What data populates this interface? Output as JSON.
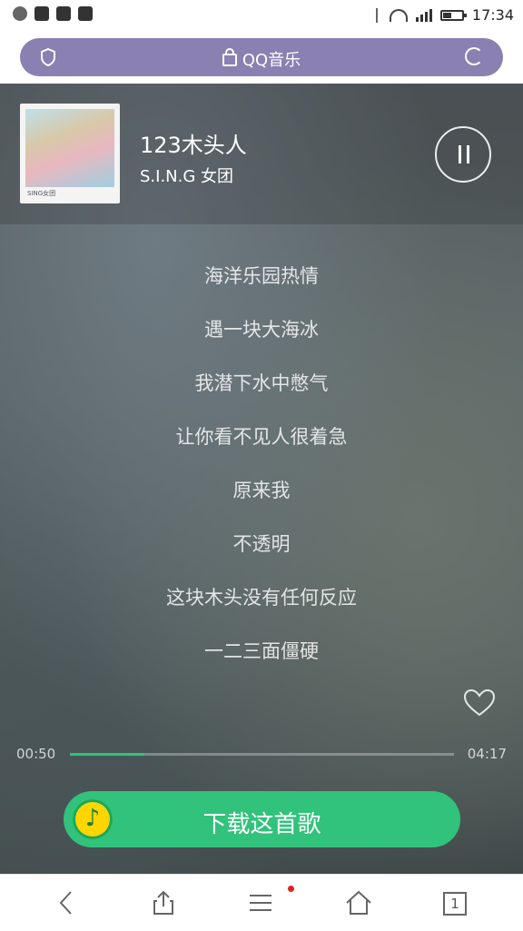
{
  "status_bar": {
    "time": "17:34",
    "left_icons": [
      "app-icon",
      "image-icon",
      "grid-app-icon",
      "app-icon"
    ],
    "right_icons": [
      "bluetooth-icon",
      "wifi-icon",
      "signal-icon",
      "battery-icon"
    ]
  },
  "address_bar": {
    "url_label": "QQ音乐",
    "bg_color": "#8a80b2"
  },
  "track": {
    "title": "123木头人",
    "artist": "S.I.N.G 女团",
    "cover_caption": "SING女团"
  },
  "lyrics": [
    "海洋乐园热情",
    "遇一块大海冰",
    "我潜下水中憋气",
    "让你看不见人很着急",
    "原来我",
    "不透明",
    "这块木头没有任何反应",
    "一二三面僵硬"
  ],
  "progress": {
    "current": "00:50",
    "total": "04:17",
    "fraction": 0.195,
    "color": "#31c27c"
  },
  "download": {
    "label": "下载这首歌",
    "color": "#31c27c"
  },
  "bottom_nav": {
    "tab_count": "1",
    "items": [
      "back-icon",
      "share-icon",
      "menu-icon",
      "home-icon",
      "tabs-icon"
    ]
  }
}
